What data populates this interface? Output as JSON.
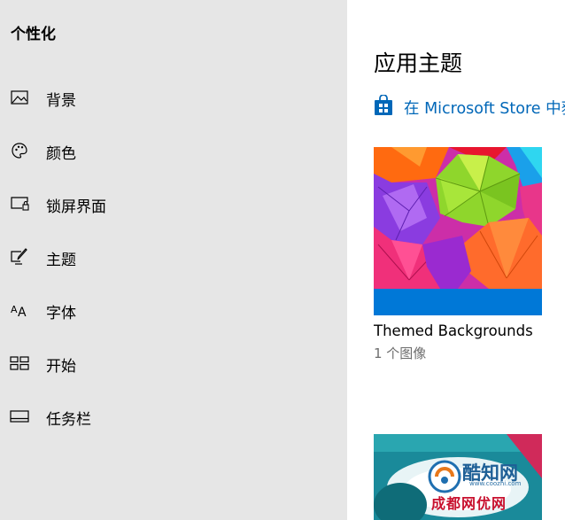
{
  "sidebar": {
    "title": "个性化",
    "items": [
      {
        "label": "背景",
        "icon": "image-icon"
      },
      {
        "label": "颜色",
        "icon": "palette-icon"
      },
      {
        "label": "锁屏界面",
        "icon": "lock-screen-icon"
      },
      {
        "label": "主题",
        "icon": "theme-brush-icon"
      },
      {
        "label": "字体",
        "icon": "font-icon"
      },
      {
        "label": "开始",
        "icon": "start-grid-icon"
      },
      {
        "label": "任务栏",
        "icon": "taskbar-icon"
      }
    ]
  },
  "main": {
    "title": "应用主题",
    "store_link": "在 Microsoft Store 中获",
    "themes": [
      {
        "name": "Themed Backgrounds",
        "count": "1 个图像"
      },
      {
        "name": "",
        "count": ""
      }
    ]
  },
  "watermark": {
    "line1": "酷知网",
    "line2": "www.coozhi.com",
    "line3": "成都网优网"
  },
  "colors": {
    "sidebar_bg": "#e6e6e6",
    "accent": "#0067b8",
    "thumb_strip": "#0078d7"
  }
}
